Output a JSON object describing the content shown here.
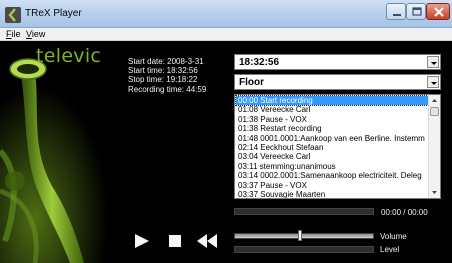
{
  "window": {
    "title": "TReX Player",
    "icon": "trex-app-icon"
  },
  "menu": {
    "file_mnemonic": "F",
    "file_rest": "ile",
    "view_mnemonic": "V",
    "view_rest": "iew"
  },
  "branding": {
    "logo_text": "televic",
    "logo_color": "#7fb224"
  },
  "recording_info": {
    "start_date": "Start date: 2008-3-31",
    "start_time": "Start time: 18:32:56",
    "stop_time": "Stop time: 19:18:22",
    "recording_time": "Recording time: 44:59"
  },
  "current_time": "18:32:56",
  "channel": "Floor",
  "events": [
    "00:00 Start recording",
    "01:08 Vereecke Carl",
    "01:38 Pause - VOX",
    "01:38 Restart recording",
    "01:48 0001.0001:Aankoop van een Berline. Instemm",
    "02:14 Eeckhout Stefaan",
    "03:04 Vereecke Carl",
    "03:11 stemming:unanimous",
    "03:14 0002.0001:Samenaankoop electriciteit. Deleg",
    "03:37 Pause - VOX",
    "03:37 Souvagie Maarten"
  ],
  "selected_event_index": 0,
  "playback": {
    "position_display": "00:00 / 00:00",
    "volume_label": "Volume",
    "volume_level": 0.47,
    "level_label": "Level"
  },
  "colors": {
    "background": "#000000",
    "selection": "#3399ff",
    "accent_green": "#7fb224"
  }
}
